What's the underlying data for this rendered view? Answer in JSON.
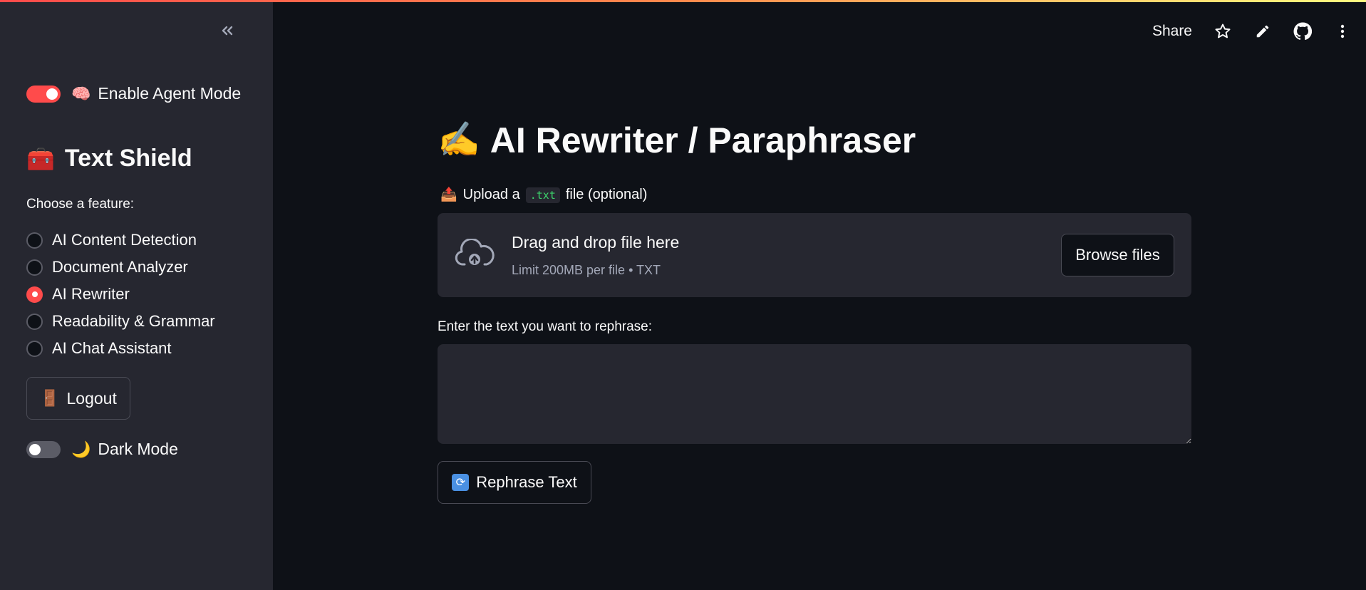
{
  "sidebar": {
    "agent_mode": {
      "label": "Enable Agent Mode",
      "emoji": "🧠",
      "enabled": true
    },
    "brand": {
      "title": "Text Shield",
      "emoji": "🧰"
    },
    "choose_label": "Choose a feature:",
    "features": [
      {
        "label": "AI Content Detection",
        "selected": false
      },
      {
        "label": "Document Analyzer",
        "selected": false
      },
      {
        "label": "AI Rewriter",
        "selected": true
      },
      {
        "label": "Readability & Grammar",
        "selected": false
      },
      {
        "label": "AI Chat Assistant",
        "selected": false
      }
    ],
    "logout": {
      "label": "Logout",
      "emoji": "🚪"
    },
    "dark_mode": {
      "label": "Dark Mode",
      "emoji": "🌙",
      "enabled": false
    }
  },
  "header": {
    "share_label": "Share",
    "icons": [
      "star-icon",
      "pencil-icon",
      "github-icon",
      "more-vertical-icon"
    ]
  },
  "main": {
    "title": "AI Rewriter / Paraphraser",
    "title_emoji": "✍️",
    "upload": {
      "emoji": "📤",
      "label_prefix": "Upload a",
      "label_code": ".txt",
      "label_suffix": "file (optional)",
      "dropzone_title": "Drag and drop file here",
      "dropzone_sub": "Limit 200MB per file • TXT",
      "browse_label": "Browse files"
    },
    "text_label": "Enter the text you want to rephrase:",
    "text_value": "",
    "rephrase_label": "Rephrase Text",
    "rephrase_emoji": "🔄"
  },
  "colors": {
    "accent": "#ff4b4b",
    "background": "#0e1117",
    "sidebar_bg": "#262730",
    "text": "#fafafa",
    "muted": "#a3a8b8"
  }
}
